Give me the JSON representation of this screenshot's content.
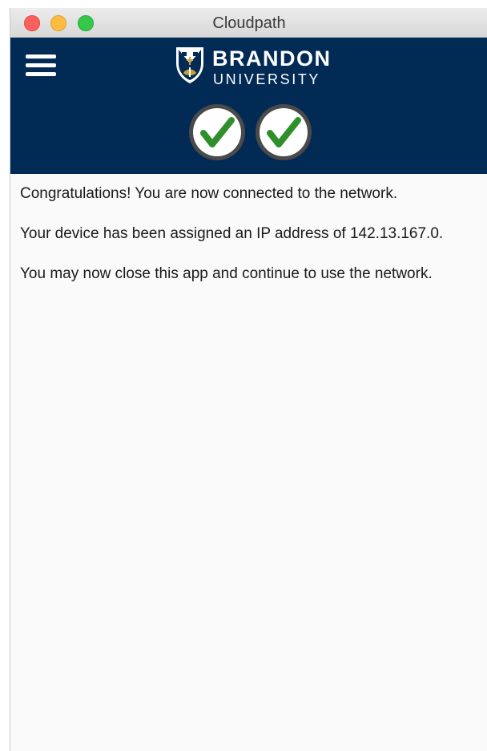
{
  "window": {
    "title": "Cloudpath"
  },
  "header": {
    "menu_icon": "hamburger-menu-icon",
    "logo": {
      "name_line1": "BRANDON",
      "name_line2": "UNIVERSITY"
    },
    "status_icons": [
      "check-circle-icon",
      "check-circle-icon"
    ],
    "colors": {
      "background": "#012a55",
      "check": "#2f8f2a"
    }
  },
  "content": {
    "congrats_message": "Congratulations! You are now connected to the network.",
    "ip_message": "Your device has been assigned an IP address of 142.13.167.0.",
    "close_message": "You may now close this app and continue to use the network."
  }
}
